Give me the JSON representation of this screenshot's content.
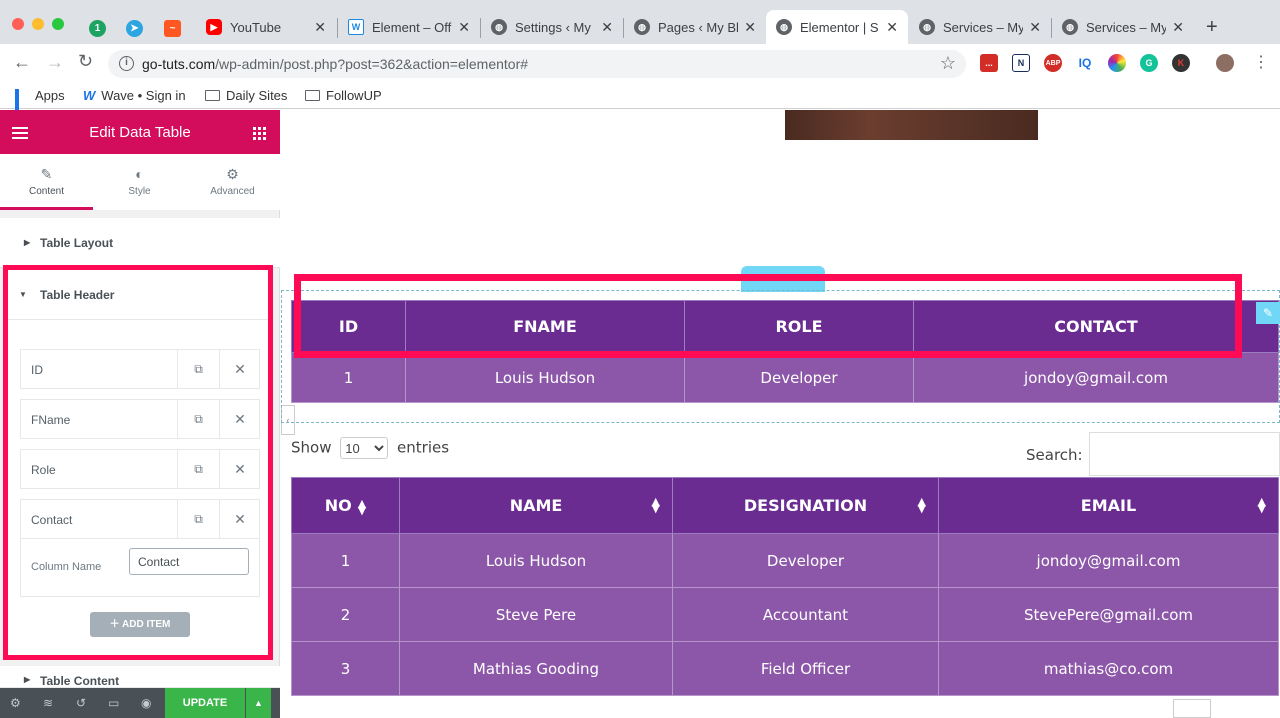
{
  "browser": {
    "tabs": [
      {
        "label": "YouTube",
        "favicon": "youtube-icon",
        "color": "#ff0000"
      },
      {
        "label": "Element – Off",
        "favicon": "wpforms-icon",
        "color": "#1e88e5"
      },
      {
        "label": "Settings ‹ My",
        "favicon": "globe-icon",
        "color": "#5f6368"
      },
      {
        "label": "Pages ‹ My Bl",
        "favicon": "globe-icon",
        "color": "#5f6368"
      },
      {
        "label": "Elementor | S",
        "favicon": "globe-icon",
        "color": "#5f6368",
        "active": true
      },
      {
        "label": "Services – My",
        "favicon": "globe-icon",
        "color": "#5f6368"
      },
      {
        "label": "Services – My",
        "favicon": "globe-icon",
        "color": "#5f6368"
      }
    ],
    "url_host": "go-tuts.com",
    "url_path": "/wp-admin/post.php?post=362&action=elementor#",
    "bookmarks": [
      "Apps",
      "Wave • Sign in",
      "Daily Sites",
      "FollowUP"
    ],
    "extensions": [
      "...",
      "N",
      "ABP",
      "IQ",
      "G",
      "K"
    ]
  },
  "panel": {
    "title": "Edit Data Table",
    "tabs": [
      "Content",
      "Style",
      "Advanced"
    ],
    "section_layout": "Table Layout",
    "section_header": "Table Header",
    "header_items": [
      "ID",
      "FName",
      "Role",
      "Contact"
    ],
    "column_name_label": "Column Name",
    "column_name_value": "Contact",
    "add_item": "ADD ITEM",
    "section_content": "Table Content",
    "update": "UPDATE"
  },
  "table1": {
    "headers": [
      "ID",
      "FNAME",
      "ROLE",
      "CONTACT"
    ],
    "row": [
      "1",
      "Louis Hudson",
      "Developer",
      "jondoy@gmail.com"
    ]
  },
  "table2": {
    "show_label": "Show",
    "entries_value": "10",
    "entries_label": "entries",
    "search_label": "Search:",
    "headers": [
      "NO",
      "NAME",
      "DESIGNATION",
      "EMAIL"
    ],
    "rows": [
      [
        "1",
        "Louis Hudson",
        "Developer",
        "jondoy@gmail.com"
      ],
      [
        "2",
        "Steve Pere",
        "Accountant",
        "StevePere@gmail.com"
      ],
      [
        "3",
        "Mathias Gooding",
        "Field Officer",
        "mathias@co.com"
      ]
    ]
  },
  "colors": {
    "accent": "#d30c5c",
    "highlight": "#ff0a55",
    "table_header": "#6a2c91",
    "table_row": "#8c57a8",
    "update": "#39b54a"
  }
}
